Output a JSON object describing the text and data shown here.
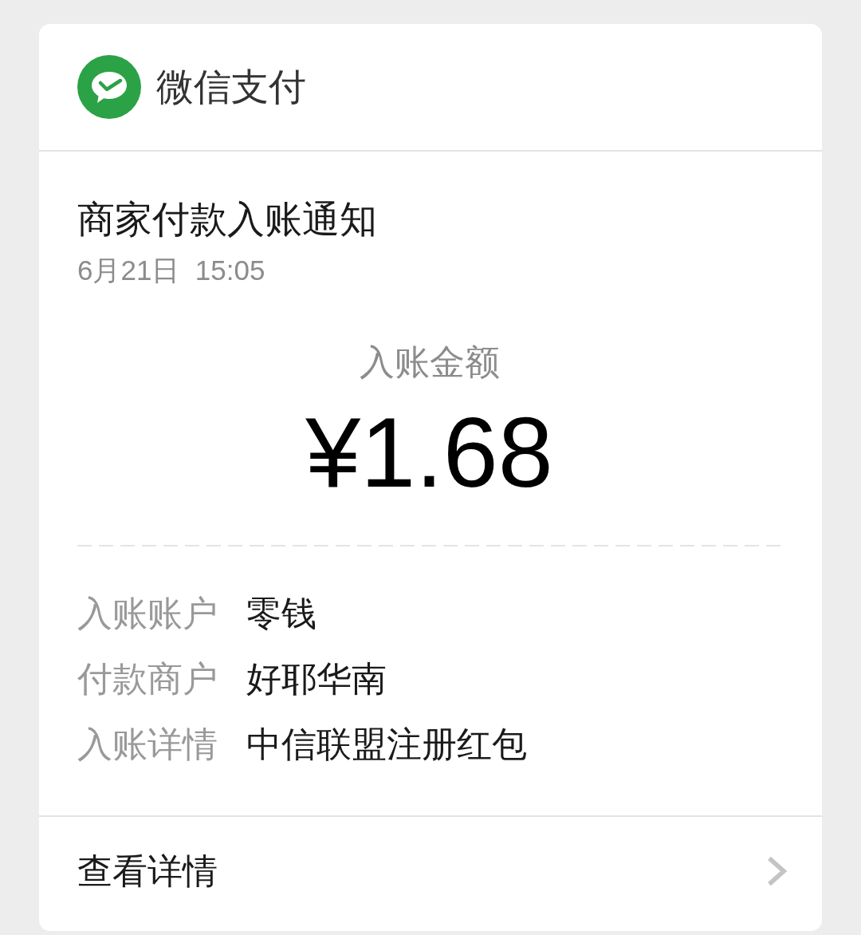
{
  "header": {
    "title": "微信支付"
  },
  "notice": {
    "title": "商家付款入账通知",
    "time": "6月21日  15:05"
  },
  "amount": {
    "label": "入账金额",
    "value": "¥1.68"
  },
  "details": [
    {
      "label": "入账账户",
      "value": "零钱"
    },
    {
      "label": "付款商户",
      "value": "好耶华南"
    },
    {
      "label": "入账详情",
      "value": "中信联盟注册红包"
    }
  ],
  "footer": {
    "link": "查看详情"
  }
}
